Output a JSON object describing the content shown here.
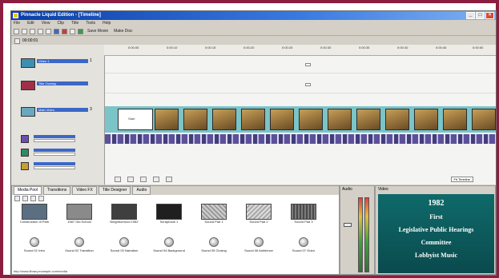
{
  "window": {
    "title": "Pinnacle Liquid Edition - [Timeline]"
  },
  "menu": [
    "File",
    "Edit",
    "View",
    "Clip",
    "Title",
    "Tools",
    "Help"
  ],
  "toolbar": {
    "btn1": "Save Movie",
    "btn2": "Make Disc"
  },
  "timeline": {
    "project_label": "00:00:01",
    "ruler_ticks": [
      "0:00:05",
      "0:00:10",
      "0:00:15",
      "0:00:20",
      "0:00:25",
      "0:00:30",
      "0:00:35",
      "0:00:40",
      "0:00:45",
      "0:00:50"
    ],
    "tracks": [
      {
        "name": "Video 1",
        "number": "1"
      },
      {
        "name": "Title Overlay",
        "number": "2"
      },
      {
        "name": "Main Video",
        "number": "3"
      },
      {
        "name": "Audio 1",
        "number": "1"
      },
      {
        "name": "Audio 2",
        "number": "2"
      },
      {
        "name": "Music",
        "number": "3"
      }
    ],
    "start_card": "Start",
    "zoom": "Fit Timeline",
    "colors": {
      "filmstrip": "#7bc4c8",
      "audio": "#4b3f8f"
    }
  },
  "library": {
    "tabs": [
      "Media Pool",
      "Transitions",
      "Video FX",
      "Title Designer",
      "Audio"
    ],
    "items": [
      {
        "label": "Construction of Park"
      },
      {
        "label": "1987 Old School"
      },
      {
        "label": "Neighborhood 1982"
      },
      {
        "label": "Scrapbook 1"
      },
      {
        "label": "Sound Pad 1"
      },
      {
        "label": "Sound Pad 2"
      },
      {
        "label": "Sound Pad 3"
      }
    ],
    "audio_items": [
      {
        "label": "Sound 01 Intro"
      },
      {
        "label": "Sound 02 Transition"
      },
      {
        "label": "Sound 03 Narration"
      },
      {
        "label": "Sound 04 Background"
      },
      {
        "label": "Sound 05 Closing"
      },
      {
        "label": "Sound 06 Ambience"
      },
      {
        "label": "Sound 07 Outro"
      }
    ],
    "status": "http://www.library.example.com/media"
  },
  "audio_mixer": {
    "label": "Audio"
  },
  "preview": {
    "label": "Video",
    "lines": [
      "1982",
      "First",
      "Legislative Public Hearings",
      "Committee",
      "Lobbyist Music"
    ]
  }
}
